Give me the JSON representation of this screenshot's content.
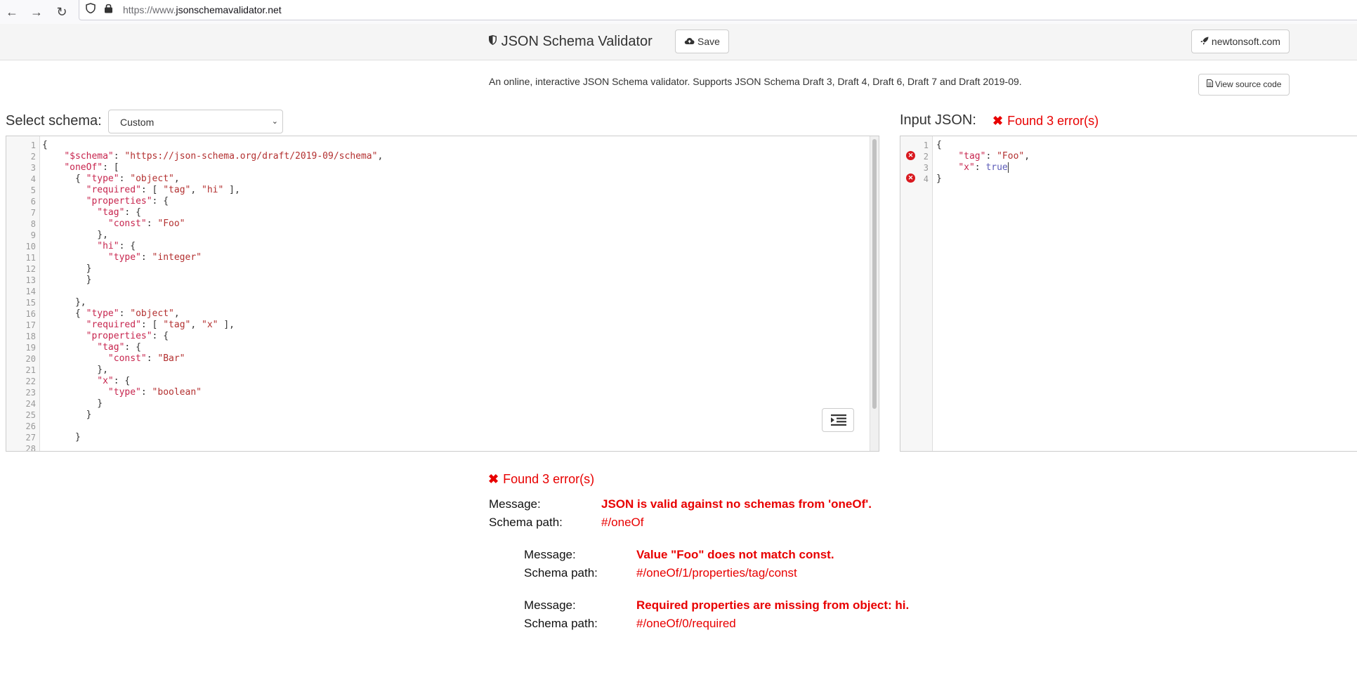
{
  "browser": {
    "url_prefix": "https://www.",
    "url_domain": "jsonschemavalidator.net"
  },
  "header": {
    "title": "JSON Schema Validator",
    "save_label": "Save",
    "newtonsoft_label": "newtonsoft.com"
  },
  "description": "An online, interactive JSON Schema validator. Supports JSON Schema Draft 3, Draft 4, Draft 6, Draft 7 and Draft 2019-09.",
  "view_source_label": "View source code",
  "schema": {
    "label": "Select schema:",
    "selected": "Custom"
  },
  "input": {
    "label": "Input JSON:",
    "error_summary": "Found 3 error(s)"
  },
  "results": {
    "summary": "Found 3 error(s)",
    "message_label": "Message:",
    "path_label": "Schema path:",
    "errors": [
      {
        "message": "JSON is valid against no schemas from 'oneOf'.",
        "path": "#/oneOf"
      },
      {
        "message": "Value \"Foo\" does not match const.",
        "path": "#/oneOf/1/properties/tag/const"
      },
      {
        "message": "Required properties are missing from object: hi.",
        "path": "#/oneOf/0/required"
      }
    ]
  },
  "icons": {
    "back": "back-arrow-icon",
    "forward": "forward-arrow-icon",
    "reload": "reload-icon",
    "shield": "shield-icon",
    "lock": "lock-icon",
    "cloud_upload": "cloud-upload-icon",
    "rocket": "rocket-icon",
    "file": "file-icon",
    "error_x": "error-x-icon",
    "indent": "indent-icon"
  },
  "colors": {
    "error": "#e80000",
    "header_bg": "#f5f5f5"
  }
}
